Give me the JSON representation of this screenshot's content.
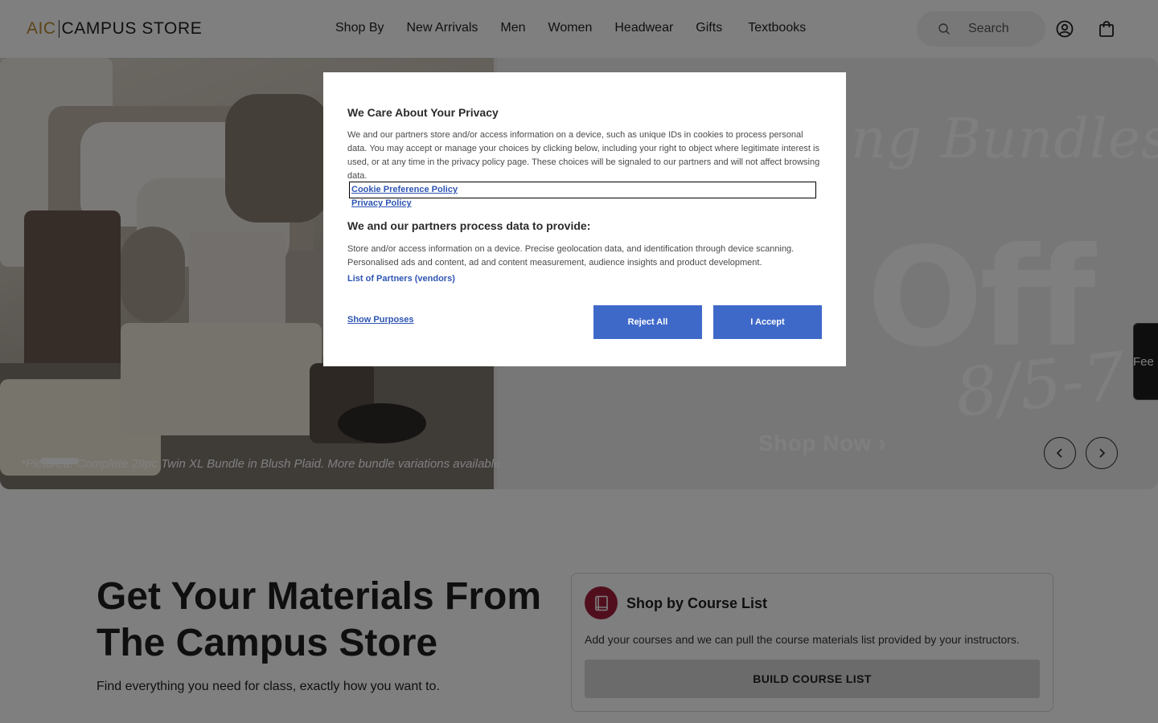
{
  "header": {
    "logo_prefix": "AIC",
    "logo_name": "CAMPUS STORE",
    "nav": [
      "Shop By",
      "New Arrivals",
      "Men",
      "Women",
      "Headwear",
      "Gifts",
      "Textbooks"
    ],
    "search_placeholder": "Search",
    "icons": [
      "search-icon",
      "account-icon",
      "cart-icon"
    ]
  },
  "hero": {
    "headline_partial": "ng Bundles",
    "discount_partial": "Off",
    "date_partial": "8/5-7",
    "cta": "Shop Now",
    "cta_arrow": "›",
    "caption": "*Pictured: Complete 29pc Twin XL Bundle in Blush Plaid. More bundle variations available.",
    "prev_icon": "‹",
    "next_icon": "›"
  },
  "feedback": {
    "label": "Fee"
  },
  "materials": {
    "title": "Get Your Materials From The Campus Store",
    "subtitle": "Find everything you need for class, exactly how you want to."
  },
  "course_card": {
    "title": "Shop by Course List",
    "description": "Add your courses and we can pull the course materials list provided by your instructors.",
    "button": "BUILD COURSE LIST",
    "icon": "book-icon",
    "accent_color": "#a31f3a"
  },
  "privacy_modal": {
    "title": "We Care About Your Privacy",
    "body": "We and our partners store and/or access information on a device, such as unique IDs in cookies to process personal data. You may accept or manage your choices by clicking below, including your right to object where legitimate interest is used, or at any time in the privacy policy page. These choices will be signaled to our partners and will not affect browsing data.",
    "link_cookie": "Cookie Preference Policy",
    "link_privacy": "Privacy Policy",
    "subtitle": "We and our partners process data to provide:",
    "purposes": "Store and/or access information on a device. Precise geolocation data, and identification through device scanning. Personalised ads and content, ad and content measurement, audience insights and product development.",
    "partners_link": "List of Partners (vendors)",
    "show_purposes": "Show Purposes",
    "reject_label": "Reject All",
    "accept_label": "I Accept",
    "button_color": "#3f69c9"
  }
}
